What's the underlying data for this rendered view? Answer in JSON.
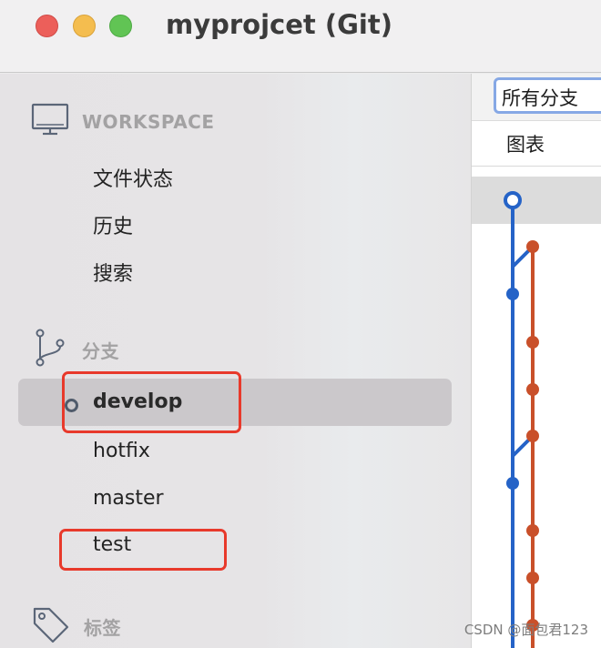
{
  "window": {
    "title": "myprojcet (Git)"
  },
  "sidebar": {
    "workspace": {
      "header": "WORKSPACE",
      "items": [
        {
          "label": "文件状态"
        },
        {
          "label": "历史"
        },
        {
          "label": "搜索"
        }
      ]
    },
    "branches": {
      "header": "分支",
      "items": [
        {
          "label": "develop",
          "selected": true,
          "current_head": true
        },
        {
          "label": "hotfix"
        },
        {
          "label": "master"
        },
        {
          "label": "test"
        }
      ]
    },
    "tags": {
      "header": "标签"
    }
  },
  "history": {
    "branch_filter": "所有分支",
    "column_graph": "图表"
  },
  "colors": {
    "annotation": "#e8392b",
    "graph_blue": "#2563c7",
    "graph_orange": "#c9502a"
  },
  "watermark": "CSDN @面包君123"
}
